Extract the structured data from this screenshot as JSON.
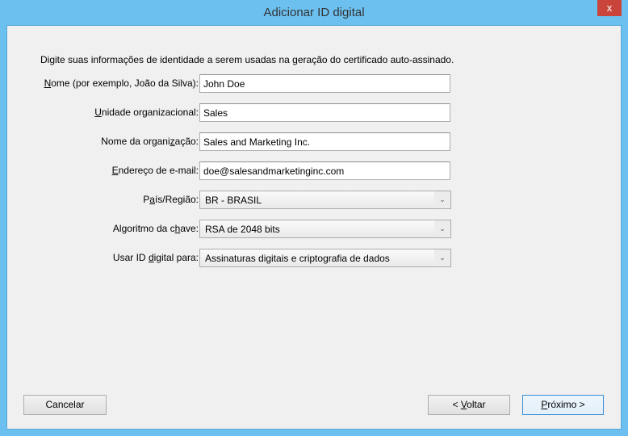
{
  "window": {
    "title": "Adicionar ID digital",
    "close": "x"
  },
  "intro": "Digite suas informações de identidade a serem usadas na geração do certificado auto-assinado.",
  "fields": [
    {
      "pre": "",
      "key": "N",
      "post": "ome (por exemplo, João da Silva):",
      "value": "John Doe",
      "type": "text"
    },
    {
      "pre": "",
      "key": "U",
      "post": "nidade organizacional:",
      "value": "Sales",
      "type": "text"
    },
    {
      "pre": "Nome da organi",
      "key": "z",
      "post": "ação:",
      "value": "Sales and Marketing Inc.",
      "type": "text"
    },
    {
      "pre": "",
      "key": "E",
      "post": "ndereço de e-mail:",
      "value": "doe@salesandmarketinginc.com",
      "type": "text"
    },
    {
      "pre": "P",
      "key": "a",
      "post": "ís/Região:",
      "value": "BR - BRASIL",
      "type": "select"
    },
    {
      "pre": "Algoritmo da c",
      "key": "h",
      "post": "ave:",
      "value": "RSA de 2048 bits",
      "type": "select"
    },
    {
      "pre": "Usar ID ",
      "key": "d",
      "post": "igital para:",
      "value": "Assinaturas digitais e criptografia de dados",
      "type": "select"
    }
  ],
  "buttons": {
    "cancel": "Cancelar",
    "back_pre": "< ",
    "back_key": "V",
    "back_post": "oltar",
    "next_key": "P",
    "next_post": "róximo >"
  }
}
